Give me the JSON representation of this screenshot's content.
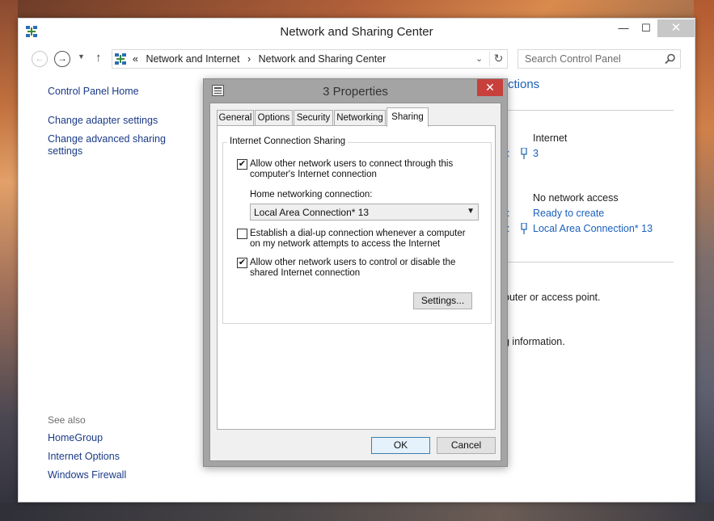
{
  "window": {
    "title": "Network and Sharing Center",
    "controls": {
      "minimize": "—",
      "maximize": "☐",
      "close": "✕"
    }
  },
  "address": {
    "separator": "«",
    "crumbs": [
      "Network and Internet",
      "Network and Sharing Center"
    ],
    "crumb_arrow": "›",
    "search_placeholder": "Search Control Panel"
  },
  "sidebar": {
    "items": [
      {
        "label": "Control Panel Home"
      },
      {
        "label": "Change adapter settings"
      },
      {
        "label": "Change advanced sharing settings"
      }
    ],
    "see_also_heading": "See also",
    "see_also": [
      {
        "label": "HomeGroup"
      },
      {
        "label": "Internet Options"
      },
      {
        "label": "Windows Firewall"
      }
    ]
  },
  "background": {
    "heading_fragment": "ctions",
    "network1": {
      "access_type": "Internet",
      "connection": "3"
    },
    "network2": {
      "access_type": "No network access",
      "homegroup": "Ready to create",
      "connection": "Local Area Connection* 13"
    },
    "colon": ":",
    "text1": "puter or access point.",
    "text2": "g information."
  },
  "dialog": {
    "title": "3 Properties",
    "tabs": [
      "General",
      "Options",
      "Security",
      "Networking",
      "Sharing"
    ],
    "active_tab": "Sharing",
    "group_title": "Internet Connection Sharing",
    "option_allow_connect": {
      "checked": true,
      "check_mark": "✔",
      "label": "Allow other network users to connect through this computer's Internet connection"
    },
    "home_network_label": "Home networking connection:",
    "home_network_value": "Local Area Connection* 13",
    "option_dialup": {
      "checked": false,
      "label": "Establish a dial-up connection whenever a computer on my network attempts to access the Internet"
    },
    "option_allow_control": {
      "checked": true,
      "check_mark": "✔",
      "label": "Allow other network users to control or disable the shared Internet connection"
    },
    "settings_button": "Settings...",
    "ok_button": "OK",
    "cancel_button": "Cancel"
  }
}
